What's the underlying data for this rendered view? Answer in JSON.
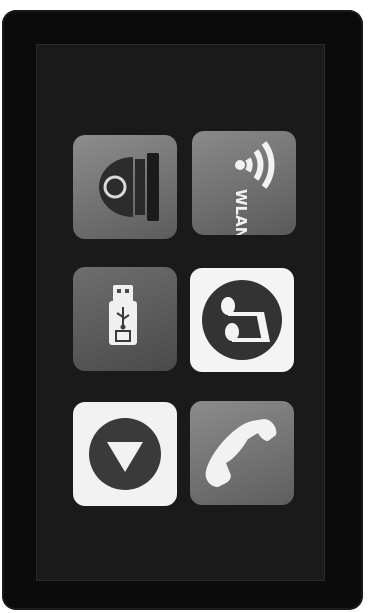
{
  "screen": {
    "tiles": [
      {
        "icon": "dome-camera-icon"
      },
      {
        "icon": "wlan-icon",
        "label": "WLAN"
      },
      {
        "icon": "usb-drive-icon"
      },
      {
        "icon": "music-note-icon"
      },
      {
        "icon": "down-arrow-icon"
      },
      {
        "icon": "phone-handset-icon"
      }
    ]
  }
}
